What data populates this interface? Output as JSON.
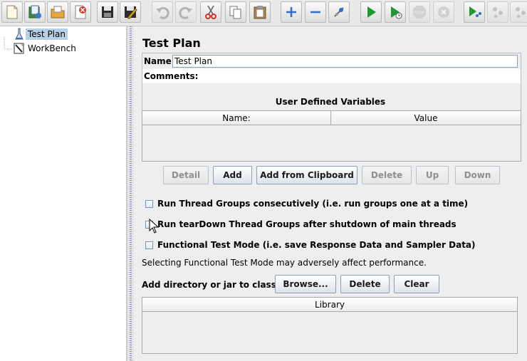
{
  "toolbar": {
    "buttons": [
      {
        "name": "new-icon",
        "enabled": true
      },
      {
        "name": "templates-icon",
        "enabled": true
      },
      {
        "name": "open-icon",
        "enabled": true
      },
      {
        "name": "close-icon",
        "enabled": true
      },
      {
        "name": "save-icon",
        "enabled": true
      },
      {
        "name": "save-as-icon",
        "enabled": true
      },
      {
        "name": "undo-icon",
        "enabled": false
      },
      {
        "name": "redo-icon",
        "enabled": false
      },
      {
        "name": "cut-icon",
        "enabled": true
      },
      {
        "name": "copy-icon",
        "enabled": true
      },
      {
        "name": "paste-icon",
        "enabled": true
      },
      {
        "name": "expand-icon",
        "enabled": true
      },
      {
        "name": "collapse-icon",
        "enabled": true
      },
      {
        "name": "toggle-icon",
        "enabled": true
      },
      {
        "name": "start-icon",
        "enabled": true
      },
      {
        "name": "start-no-timers-icon",
        "enabled": true
      },
      {
        "name": "stop-icon",
        "enabled": false
      },
      {
        "name": "shutdown-icon",
        "enabled": false
      },
      {
        "name": "remote-start-icon",
        "enabled": true
      },
      {
        "name": "remote-stop-icon",
        "enabled": false
      },
      {
        "name": "remote-shutdown-icon",
        "enabled": false
      }
    ]
  },
  "tree": {
    "items": [
      {
        "label": "Test Plan",
        "selected": true,
        "icon": "test-plan-icon"
      },
      {
        "label": "WorkBench",
        "selected": false,
        "icon": "workbench-icon"
      }
    ]
  },
  "panel": {
    "title": "Test Plan",
    "name_label": "Name:",
    "name_value": "Test Plan",
    "comments_label": "Comments:",
    "udv": {
      "title": "User Defined Variables",
      "columns": [
        "Name:",
        "Value"
      ],
      "rows": []
    },
    "udv_buttons": [
      {
        "label": "Detail",
        "enabled": false
      },
      {
        "label": "Add",
        "enabled": true
      },
      {
        "label": "Add from Clipboard",
        "enabled": true
      },
      {
        "label": "Delete",
        "enabled": false
      },
      {
        "label": "Up",
        "enabled": false
      },
      {
        "label": "Down",
        "enabled": false
      }
    ],
    "options": [
      {
        "label": "Run Thread Groups consecutively (i.e. run groups one at a time)",
        "checked": false
      },
      {
        "label": "Run tearDown Thread Groups after shutdown of main threads",
        "checked": false
      },
      {
        "label": "Functional Test Mode (i.e. save Response Data and Sampler Data)",
        "checked": false
      }
    ],
    "functional_note": "Selecting Functional Test Mode may adversely affect performance.",
    "classpath": {
      "label": "Add directory or jar to classpath",
      "browse": "Browse...",
      "delete": "Delete",
      "clear": "Clear",
      "column": "Library"
    }
  },
  "colors": {
    "selection": "#b8cfe5",
    "start_green": "#1e9a2e",
    "expand_blue": "#2f6fc6",
    "cut_red": "#c8342a"
  }
}
